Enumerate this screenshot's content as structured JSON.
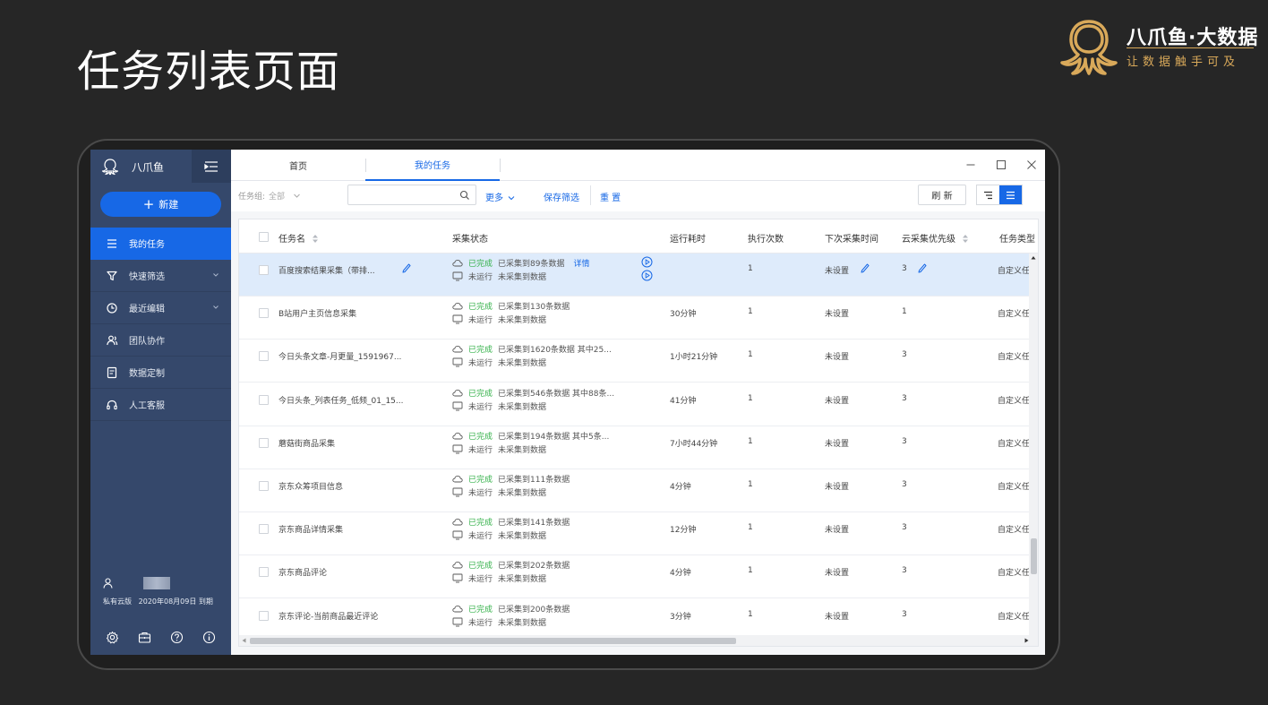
{
  "slide": {
    "title": "任务列表页面"
  },
  "brand": {
    "name": "八爪鱼·大数据",
    "slogan": "让数据触手可及",
    "accent_color": "#d9a95a"
  },
  "sidebar": {
    "app_name": "八爪鱼",
    "new_button": "新建",
    "items": [
      {
        "label": "我的任务",
        "icon": "list-icon",
        "active": true
      },
      {
        "label": "快速筛选",
        "icon": "filter-icon",
        "expandable": true
      },
      {
        "label": "最近编辑",
        "icon": "clock-icon",
        "expandable": true
      },
      {
        "label": "团队协作",
        "icon": "team-icon"
      },
      {
        "label": "数据定制",
        "icon": "document-icon"
      },
      {
        "label": "人工客服",
        "icon": "headset-icon"
      }
    ],
    "edition": "私有云版",
    "expiry": "2020年08月09日 到期",
    "bottom_icons": [
      "gear-icon",
      "briefcase-icon",
      "help-icon",
      "info-icon"
    ],
    "bg_color": "#35486b",
    "active_color": "#1768e6"
  },
  "tabs": [
    {
      "label": "首页"
    },
    {
      "label": "我的任务",
      "active": true
    }
  ],
  "filters": {
    "group_label": "任务组:",
    "group_value": "全部",
    "search_placeholder": "",
    "more": "更多",
    "save_filter": "保存筛选",
    "reset": "重 置",
    "refresh": "刷 新"
  },
  "table": {
    "columns": [
      "任务名",
      "采集状态",
      "运行耗时",
      "执行次数",
      "下次采集时间",
      "云采集优先级",
      "任务类型"
    ],
    "rows": [
      {
        "name": "百度搜索结果采集（带排...",
        "cloud_status": "已完成",
        "cloud_text": "已采集到89条数据",
        "detail": "详情",
        "local_status": "未运行",
        "local_text": "未采集到数据",
        "duration": "",
        "runs": "1",
        "next": "未设置",
        "priority": "3",
        "type": "自定义任",
        "selected": true
      },
      {
        "name": "B站用户主页信息采集",
        "cloud_status": "已完成",
        "cloud_text": "已采集到130条数据",
        "local_status": "未运行",
        "local_text": "未采集到数据",
        "duration": "30分钟",
        "runs": "1",
        "next": "未设置",
        "priority": "1",
        "type": "自定义任"
      },
      {
        "name": "今日头条文章-月更量_1591967...",
        "cloud_status": "已完成",
        "cloud_text": "已采集到1620条数据 其中25...",
        "local_status": "未运行",
        "local_text": "未采集到数据",
        "duration": "1小时21分钟",
        "runs": "1",
        "next": "未设置",
        "priority": "3",
        "type": "自定义任"
      },
      {
        "name": "今日头条_列表任务_低频_01_15...",
        "cloud_status": "已完成",
        "cloud_text": "已采集到546条数据 其中88条...",
        "local_status": "未运行",
        "local_text": "未采集到数据",
        "duration": "41分钟",
        "runs": "1",
        "next": "未设置",
        "priority": "3",
        "type": "自定义任"
      },
      {
        "name": "蘑菇街商品采集",
        "cloud_status": "已完成",
        "cloud_text": "已采集到194条数据 其中5条...",
        "local_status": "未运行",
        "local_text": "未采集到数据",
        "duration": "7小时44分钟",
        "runs": "1",
        "next": "未设置",
        "priority": "3",
        "type": "自定义任"
      },
      {
        "name": "京东众筹项目信息",
        "cloud_status": "已完成",
        "cloud_text": "已采集到111条数据",
        "local_status": "未运行",
        "local_text": "未采集到数据",
        "duration": "4分钟",
        "runs": "1",
        "next": "未设置",
        "priority": "3",
        "type": "自定义任"
      },
      {
        "name": "京东商品详情采集",
        "cloud_status": "已完成",
        "cloud_text": "已采集到141条数据",
        "local_status": "未运行",
        "local_text": "未采集到数据",
        "duration": "12分钟",
        "runs": "1",
        "next": "未设置",
        "priority": "3",
        "type": "自定义任"
      },
      {
        "name": "京东商品评论",
        "cloud_status": "已完成",
        "cloud_text": "已采集到202条数据",
        "local_status": "未运行",
        "local_text": "未采集到数据",
        "duration": "4分钟",
        "runs": "1",
        "next": "未设置",
        "priority": "3",
        "type": "自定义任"
      },
      {
        "name": "京东评论-当前商品最近评论",
        "cloud_status": "已完成",
        "cloud_text": "已采集到200条数据",
        "local_status": "未运行",
        "local_text": "未采集到数据",
        "duration": "3分钟",
        "runs": "1",
        "next": "未设置",
        "priority": "3",
        "type": "自定义任"
      }
    ]
  },
  "colors": {
    "accent": "#1768e6",
    "done": "#34b14a",
    "selected_row": "#deebfb"
  }
}
